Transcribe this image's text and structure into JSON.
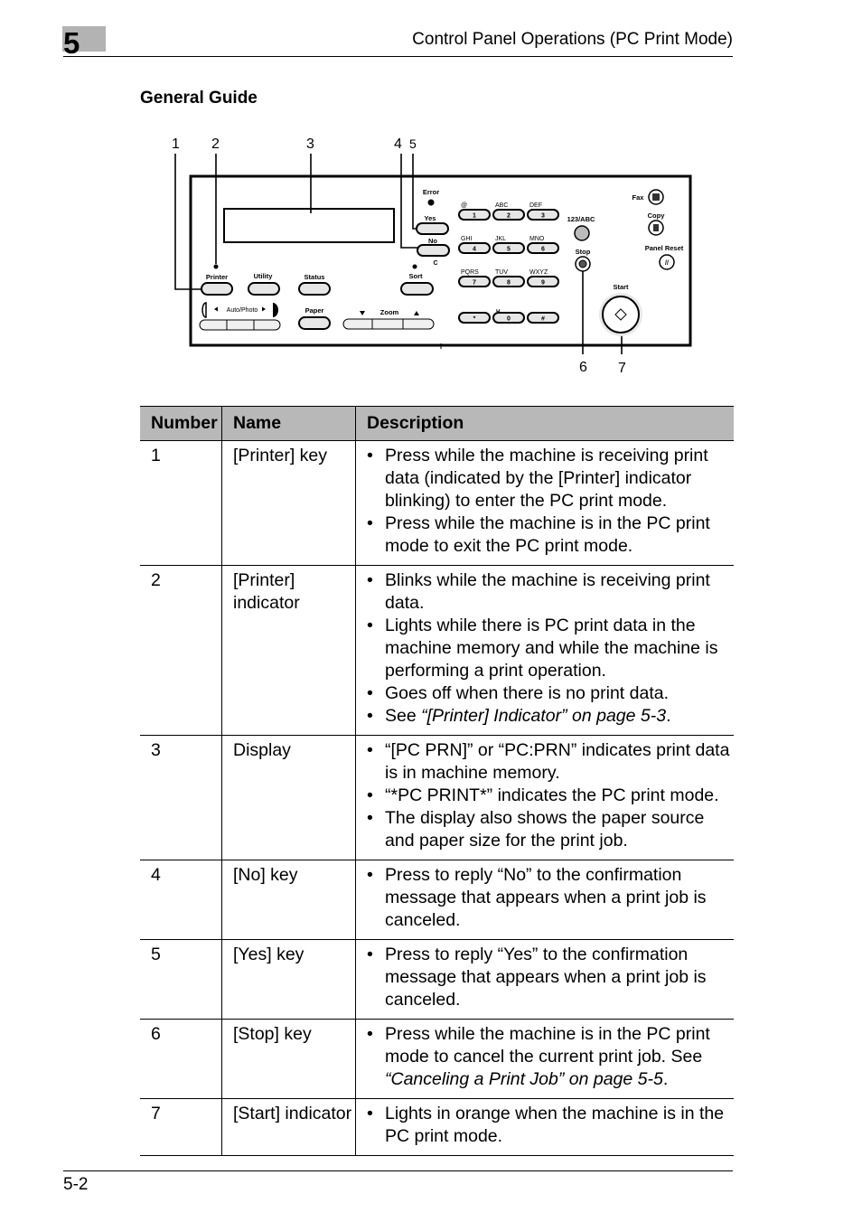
{
  "header": {
    "chapter_number": "5",
    "running_title": "Control Panel Operations (PC Print Mode)"
  },
  "section_title": "General Guide",
  "diagram": {
    "callouts": [
      "1",
      "2",
      "3",
      "4",
      "5",
      "6",
      "7"
    ],
    "labels": {
      "error": "Error",
      "yes": "Yes",
      "no": "No",
      "c": "C",
      "sort": "Sort",
      "printer": "Printer",
      "utility": "Utility",
      "status": "Status",
      "auto_photo": "Auto/Photo",
      "paper": "Paper",
      "zoom": "Zoom",
      "mode_123abc": "123/ABC",
      "stop": "Stop",
      "start": "Start",
      "fax": "Fax",
      "copy": "Copy",
      "panel_reset": "Panel Reset"
    },
    "keypad": [
      {
        "key": "1",
        "letters": "@"
      },
      {
        "key": "2",
        "letters": "ABC"
      },
      {
        "key": "3",
        "letters": "DEF"
      },
      {
        "key": "4",
        "letters": "GHI"
      },
      {
        "key": "5",
        "letters": "JKL"
      },
      {
        "key": "6",
        "letters": "MNO"
      },
      {
        "key": "7",
        "letters": "PQRS"
      },
      {
        "key": "8",
        "letters": "TUV"
      },
      {
        "key": "9",
        "letters": "WXYZ"
      },
      {
        "key": "*",
        "letters": ""
      },
      {
        "key": "0",
        "letters": "␣"
      },
      {
        "key": "#",
        "letters": ""
      }
    ]
  },
  "table": {
    "headers": [
      "Number",
      "Name",
      "Description"
    ],
    "rows": [
      {
        "number": "1",
        "name": "[Printer] key",
        "bullets": [
          {
            "text": "Press while the machine is receiving print data (indicated by the [Printer] indicator blinking) to enter the PC print mode.",
            "ref": ""
          },
          {
            "text": "Press while the machine is in the PC print mode to exit the PC print mode.",
            "ref": ""
          }
        ]
      },
      {
        "number": "2",
        "name": "[Printer] indicator",
        "bullets": [
          {
            "text": "Blinks while the machine is receiving print data.",
            "ref": ""
          },
          {
            "text": "Lights while there is PC print data in the machine memory and while the machine is performing a print operation.",
            "ref": ""
          },
          {
            "text": "Goes off when there is no print data.",
            "ref": ""
          },
          {
            "text": "See ",
            "ref": "“[Printer] Indicator” on page 5-3",
            "after": "."
          }
        ]
      },
      {
        "number": "3",
        "name": "Display",
        "bullets": [
          {
            "text": "“[PC PRN]” or “PC:PRN” indicates print data is in machine memory.",
            "ref": ""
          },
          {
            "text": "“*PC PRINT*” indicates the PC print mode.",
            "ref": ""
          },
          {
            "text": "The display also shows the paper source and paper size for the print job.",
            "ref": ""
          }
        ]
      },
      {
        "number": "4",
        "name": "[No] key",
        "bullets": [
          {
            "text": "Press to reply “No” to the confirmation message that appears when a print job is canceled.",
            "ref": ""
          }
        ]
      },
      {
        "number": "5",
        "name": "[Yes] key",
        "bullets": [
          {
            "text": "Press to reply “Yes” to the confirmation message that appears when a print job is canceled.",
            "ref": ""
          }
        ]
      },
      {
        "number": "6",
        "name": "[Stop] key",
        "bullets": [
          {
            "text": "Press while the machine is in the PC print mode to cancel the current print job. See ",
            "ref": "“Canceling a Print Job” on page 5-5",
            "after": "."
          }
        ]
      },
      {
        "number": "7",
        "name": "[Start] indicator",
        "bullets": [
          {
            "text": "Lights in orange when the machine is in the PC print mode.",
            "ref": ""
          }
        ]
      }
    ]
  },
  "footer": {
    "page_number": "5-2"
  }
}
